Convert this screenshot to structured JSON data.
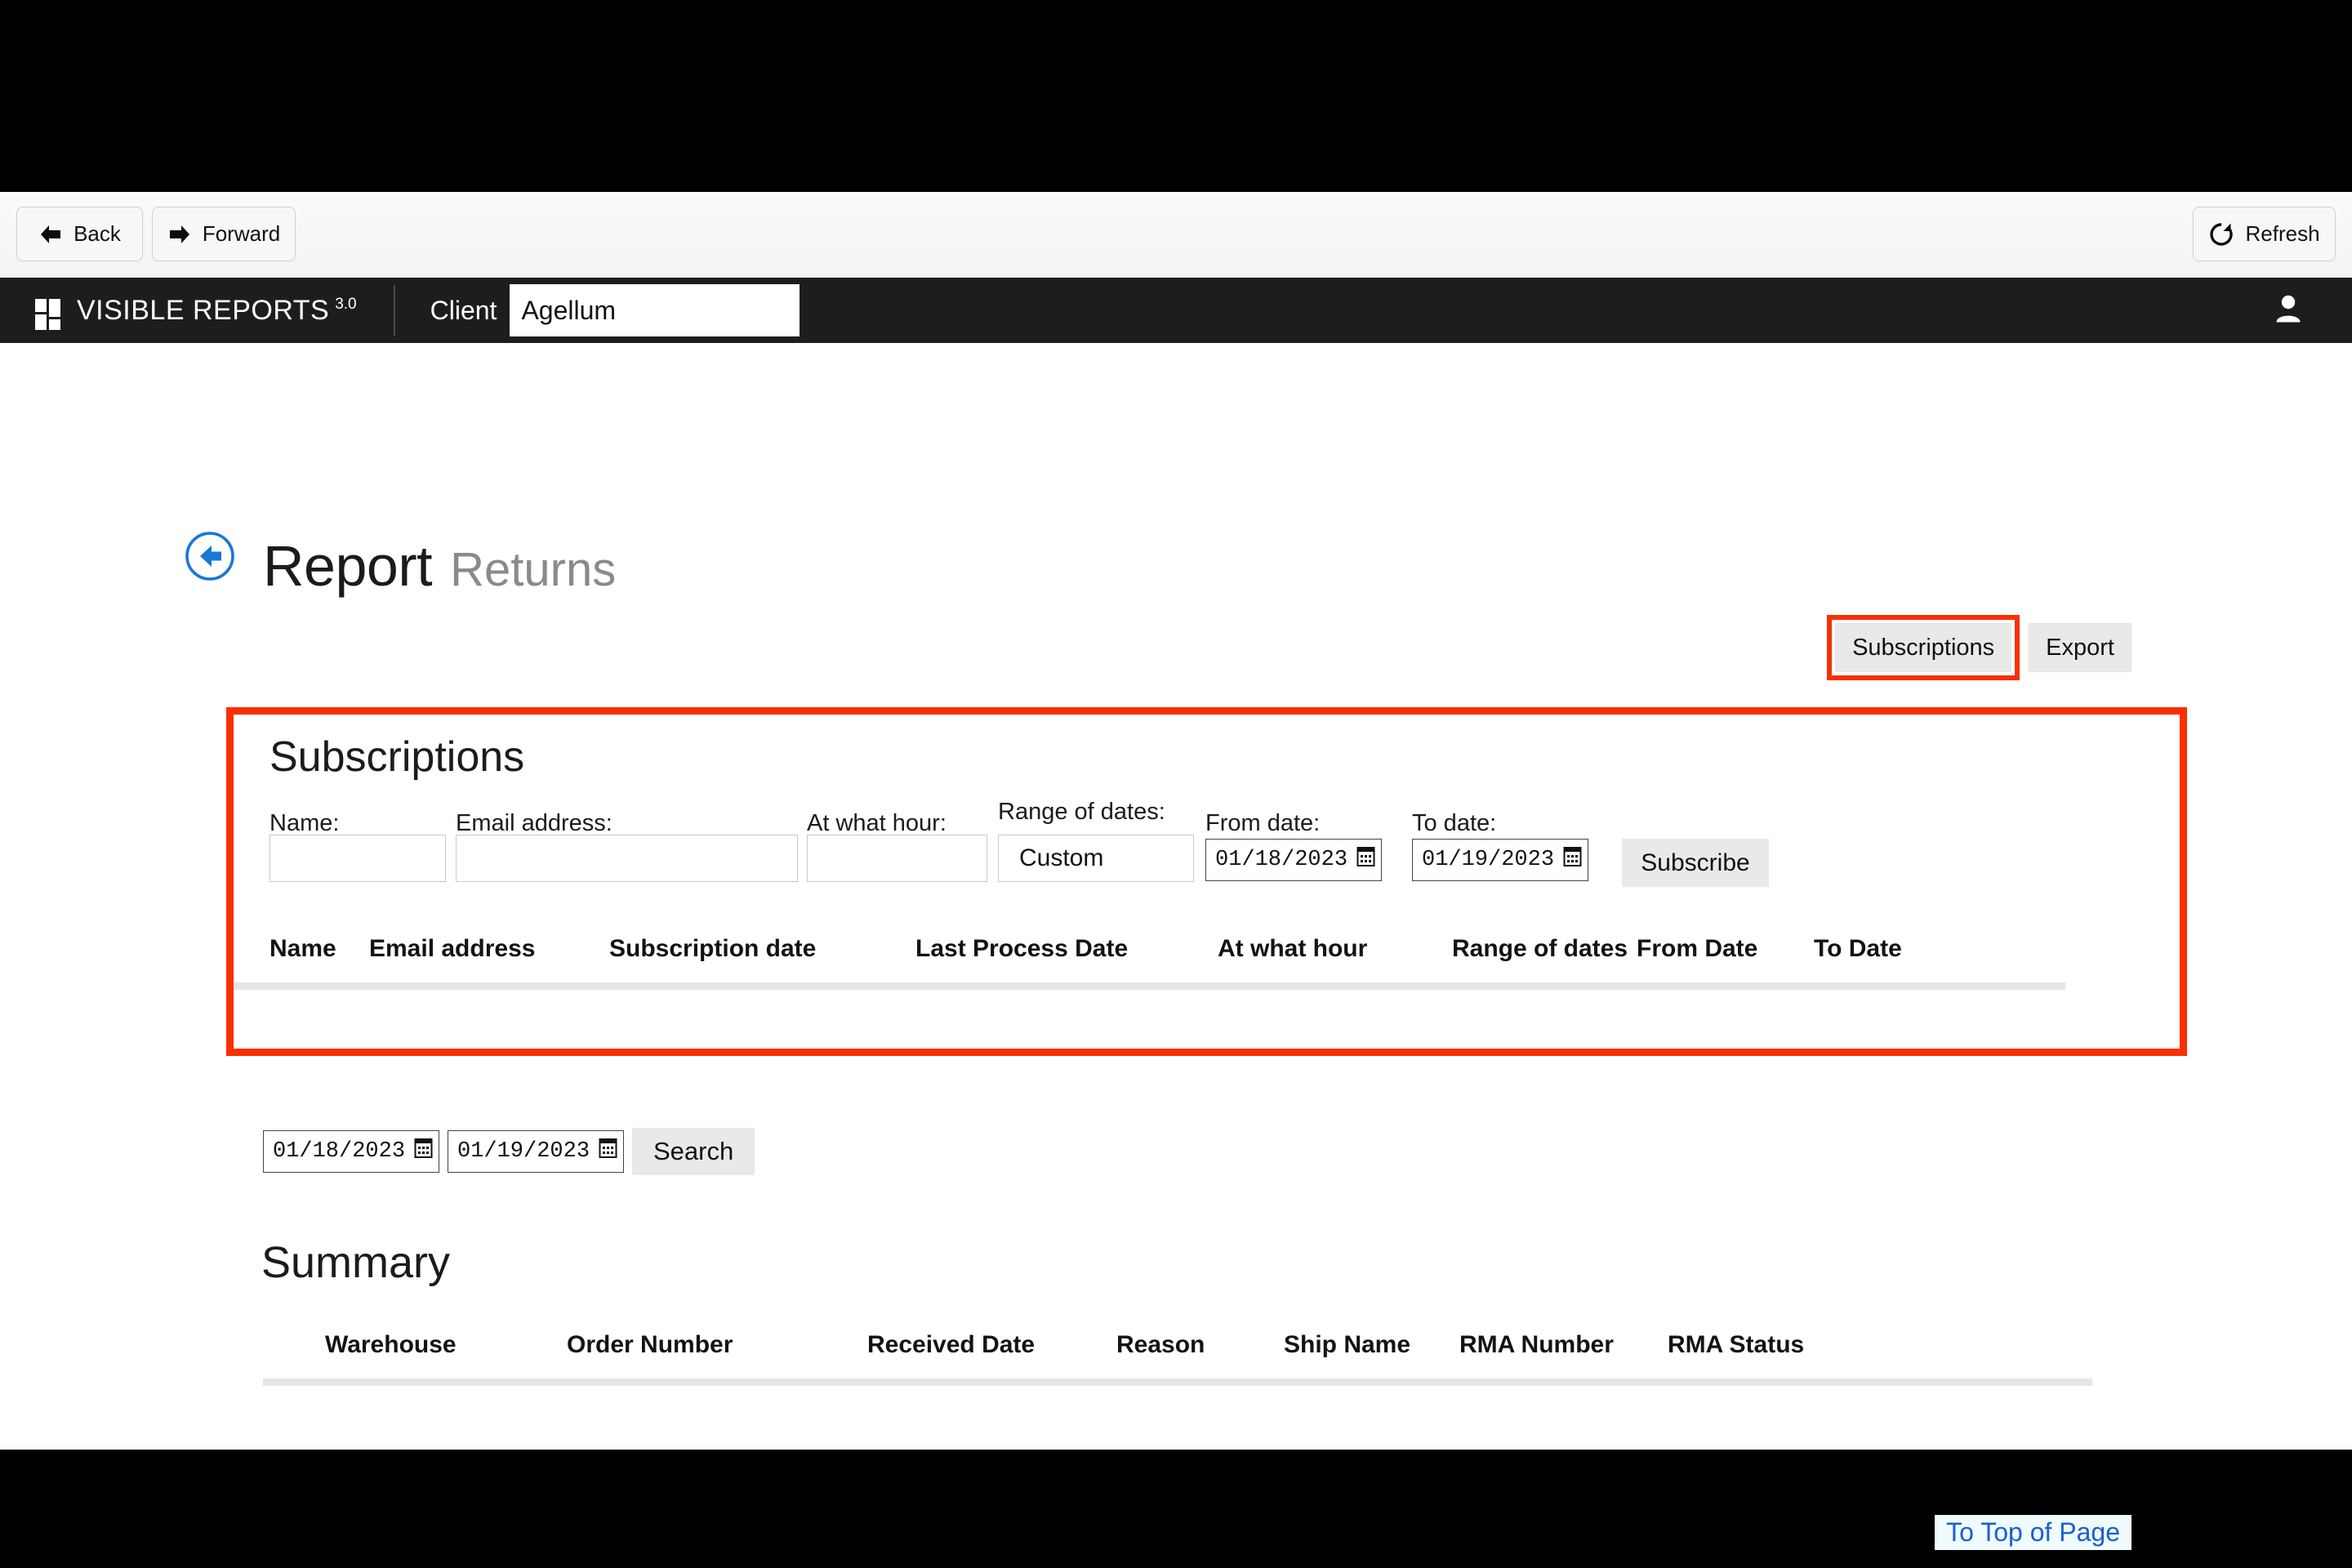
{
  "browser_nav": {
    "back_label": "Back",
    "forward_label": "Forward",
    "refresh_label": "Refresh",
    "back_icon": "arrow-left-icon",
    "forward_icon": "arrow-right-icon",
    "refresh_icon": "refresh-icon"
  },
  "app_header": {
    "brand_name": "VISIBLE REPORTS",
    "brand_version": "3.0",
    "logo_icon": "four-squares-logo-icon",
    "client_label": "Client",
    "client_value": "Agellum",
    "client_placeholder": "",
    "user_icon": "user-account-icon"
  },
  "page": {
    "back_icon": "back-circle-arrow-icon",
    "title": "Report",
    "subtitle": "Returns"
  },
  "actions": {
    "subscriptions_label": "Subscriptions",
    "export_label": "Export",
    "highlight_color": "#fa2f00"
  },
  "subscriptions_panel": {
    "heading": "Subscriptions",
    "form": {
      "name_label": "Name:",
      "name_value": "",
      "email_label": "Email address:",
      "email_value": "",
      "hour_label": "At what hour:",
      "hour_value": "",
      "range_label": "Range of dates:",
      "range_value": "Custom",
      "from_label": "From date:",
      "from_value": "01/18/2023",
      "to_label": "To date:",
      "to_value": "01/19/2023",
      "subscribe_label": "Subscribe",
      "calendar_icon": "calendar-icon"
    },
    "table": {
      "columns": [
        "Name",
        "Email address",
        "Subscription date",
        "Last Process Date",
        "At what hour",
        "Range of dates",
        "From Date",
        "To Date"
      ],
      "rows": []
    }
  },
  "search": {
    "from_value": "01/18/2023",
    "to_value": "01/19/2023",
    "button_label": "Search",
    "calendar_icon": "calendar-icon"
  },
  "summary": {
    "heading": "Summary",
    "table": {
      "columns": [
        "Warehouse",
        "Order Number",
        "Received Date",
        "Reason",
        "Ship Name",
        "RMA Number",
        "RMA Status"
      ],
      "rows": []
    }
  },
  "footer": {
    "to_top_label": "To Top of Page"
  }
}
